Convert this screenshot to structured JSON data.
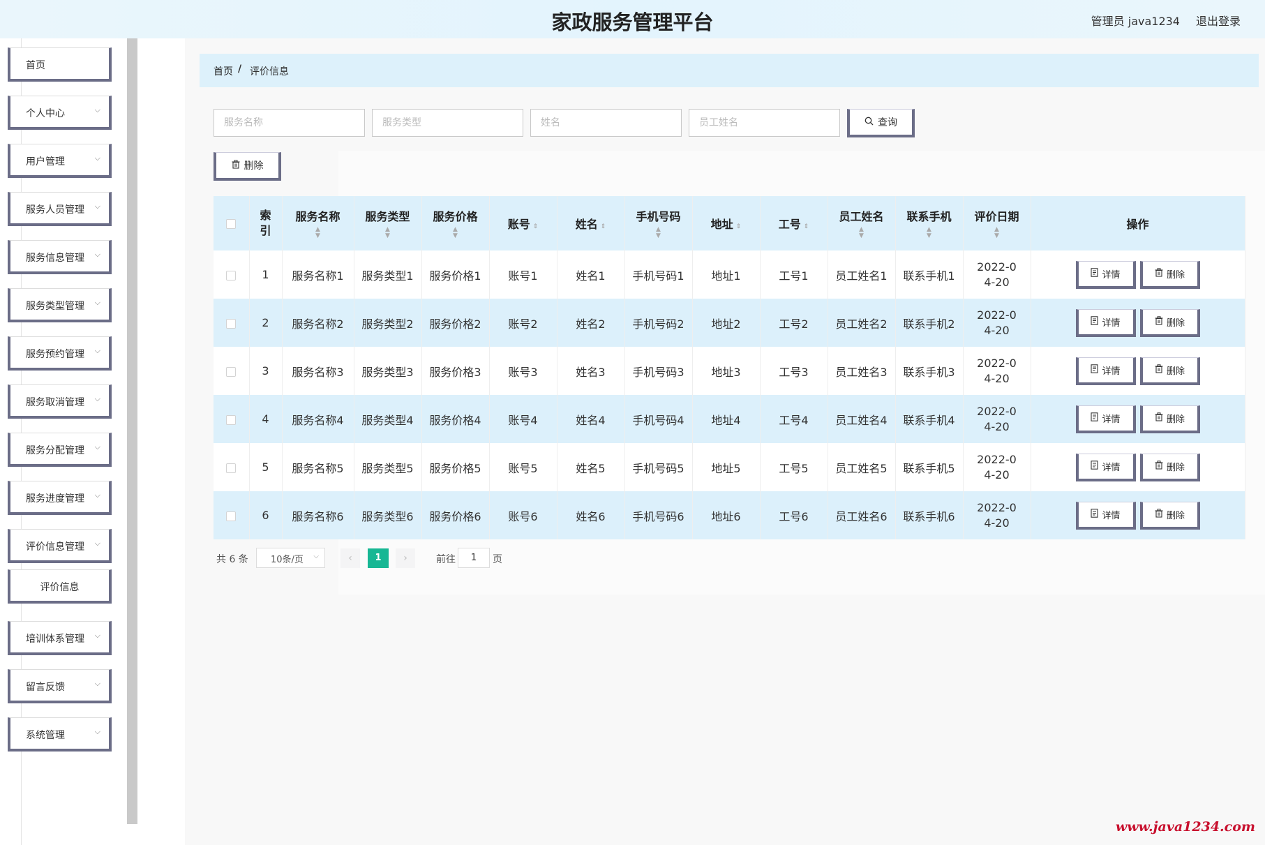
{
  "header": {
    "title": "家政服务管理平台",
    "user": "管理员 java1234",
    "logout": "退出登录"
  },
  "sidebar": {
    "items": [
      {
        "label": "首页",
        "has_chevron": false
      },
      {
        "label": "个人中心",
        "has_chevron": true
      },
      {
        "label": "用户管理",
        "has_chevron": true
      },
      {
        "label": "服务人员管理",
        "has_chevron": true
      },
      {
        "label": "服务信息管理",
        "has_chevron": true
      },
      {
        "label": "服务类型管理",
        "has_chevron": true
      },
      {
        "label": "服务预约管理",
        "has_chevron": true
      },
      {
        "label": "服务取消管理",
        "has_chevron": true
      },
      {
        "label": "服务分配管理",
        "has_chevron": true
      },
      {
        "label": "服务进度管理",
        "has_chevron": true
      },
      {
        "label": "评价信息管理",
        "has_chevron": true
      },
      {
        "label": "评价信息",
        "has_chevron": false
      },
      {
        "label": "培训体系管理",
        "has_chevron": true
      },
      {
        "label": "留言反馈",
        "has_chevron": true
      },
      {
        "label": "系统管理",
        "has_chevron": true
      }
    ]
  },
  "breadcrumb": {
    "home": "首页",
    "separator": "/",
    "current": "评价信息"
  },
  "search": {
    "placeholders": [
      "服务名称",
      "服务类型",
      "姓名",
      "员工姓名"
    ],
    "query_label": "查询"
  },
  "toolbar": {
    "delete_label": "删除"
  },
  "table": {
    "headers": [
      "索引",
      "服务名称",
      "服务类型",
      "服务价格",
      "账号",
      "姓名",
      "手机号码",
      "地址",
      "工号",
      "员工姓名",
      "联系手机",
      "评价日期",
      "操作"
    ],
    "rows": [
      [
        "1",
        "服务名称1",
        "服务类型1",
        "服务价格1",
        "账号1",
        "姓名1",
        "手机号码1",
        "地址1",
        "工号1",
        "员工姓名1",
        "联系手机1",
        "2022-04-20"
      ],
      [
        "2",
        "服务名称2",
        "服务类型2",
        "服务价格2",
        "账号2",
        "姓名2",
        "手机号码2",
        "地址2",
        "工号2",
        "员工姓名2",
        "联系手机2",
        "2022-04-20"
      ],
      [
        "3",
        "服务名称3",
        "服务类型3",
        "服务价格3",
        "账号3",
        "姓名3",
        "手机号码3",
        "地址3",
        "工号3",
        "员工姓名3",
        "联系手机3",
        "2022-04-20"
      ],
      [
        "4",
        "服务名称4",
        "服务类型4",
        "服务价格4",
        "账号4",
        "姓名4",
        "手机号码4",
        "地址4",
        "工号4",
        "员工姓名4",
        "联系手机4",
        "2022-04-20"
      ],
      [
        "5",
        "服务名称5",
        "服务类型5",
        "服务价格5",
        "账号5",
        "姓名5",
        "手机号码5",
        "地址5",
        "工号5",
        "员工姓名5",
        "联系手机5",
        "2022-04-20"
      ],
      [
        "6",
        "服务名称6",
        "服务类型6",
        "服务价格6",
        "账号6",
        "姓名6",
        "手机号码6",
        "地址6",
        "工号6",
        "员工姓名6",
        "联系手机6",
        "2022-04-20"
      ]
    ],
    "detail_label": "详情",
    "delete_label": "删除"
  },
  "pagination": {
    "total": "共 6 条",
    "page_size": "10条/页",
    "current_page": "1",
    "goto_label": "前往",
    "goto_value": "1",
    "goto_unit": "页"
  },
  "watermark": "www.java1234.com",
  "colors": {
    "accent": "#17b794",
    "header_bg": "#e3f4fd",
    "row_stripe": "#dcf0fb",
    "button_border": "#6b6d87"
  }
}
